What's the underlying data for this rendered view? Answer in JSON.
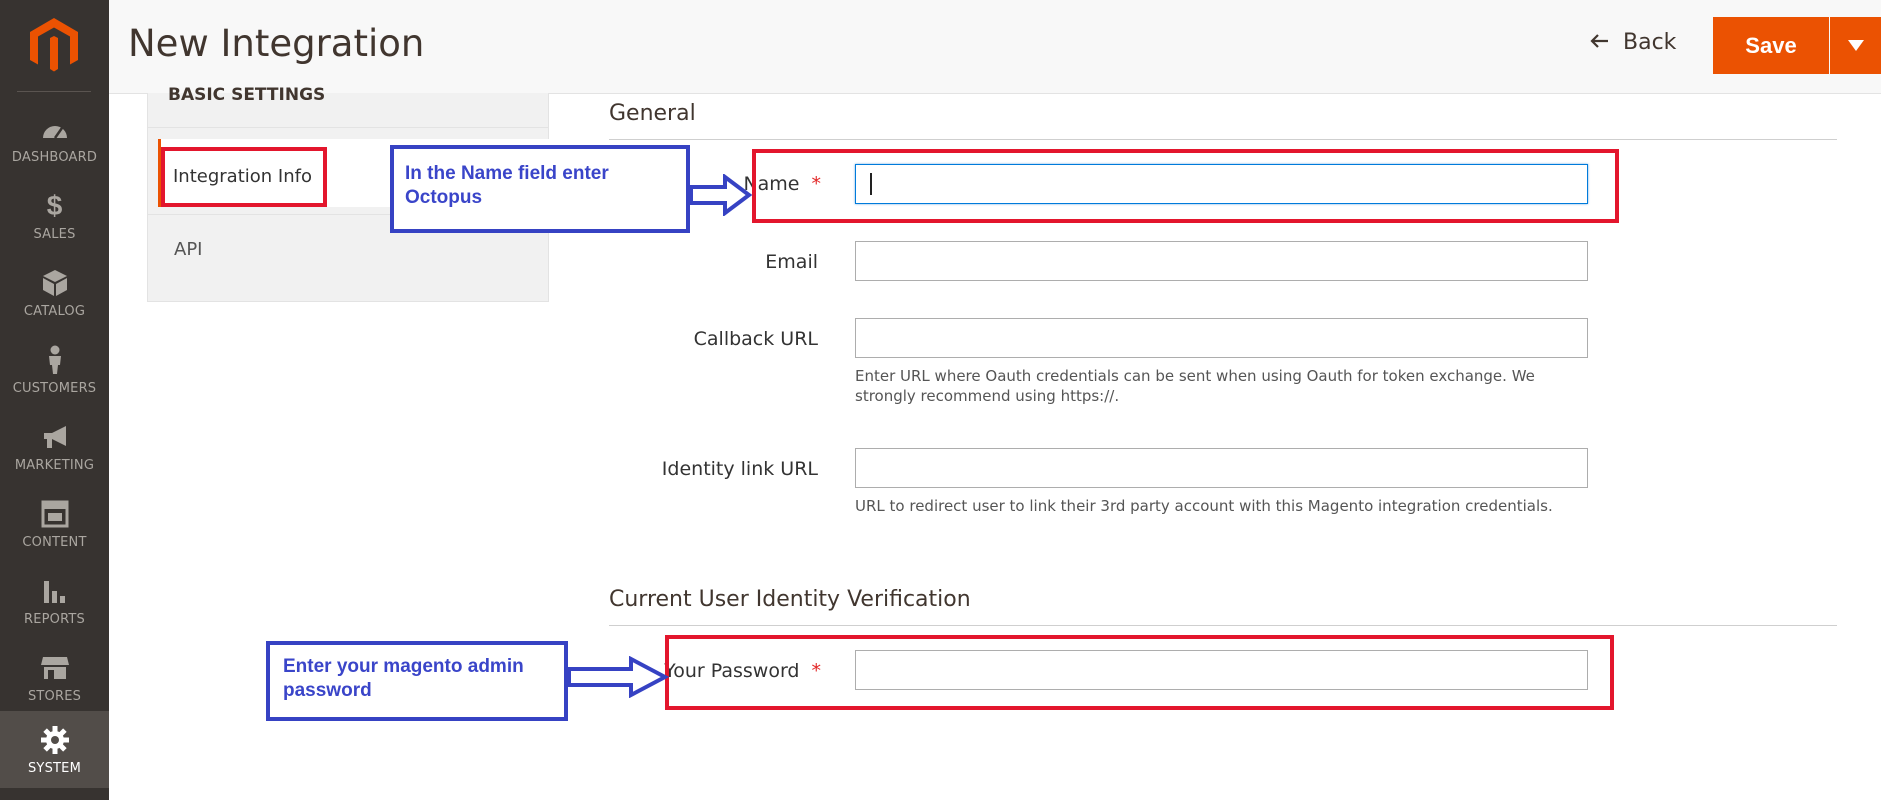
{
  "header": {
    "title": "New Integration",
    "back_label": "Back",
    "save_label": "Save"
  },
  "menu": [
    {
      "label": "DASHBOARD",
      "icon": "dashboard-icon"
    },
    {
      "label": "SALES",
      "icon": "dollar-icon"
    },
    {
      "label": "CATALOG",
      "icon": "box-icon"
    },
    {
      "label": "CUSTOMERS",
      "icon": "person-icon"
    },
    {
      "label": "MARKETING",
      "icon": "megaphone-icon"
    },
    {
      "label": "CONTENT",
      "icon": "layout-icon"
    },
    {
      "label": "REPORTS",
      "icon": "bar-chart-icon"
    },
    {
      "label": "STORES",
      "icon": "storefront-icon"
    },
    {
      "label": "SYSTEM",
      "icon": "gear-icon",
      "active": true
    }
  ],
  "tabs": {
    "heading": "BASIC SETTINGS",
    "items": [
      {
        "label": "Integration Info",
        "active": true
      },
      {
        "label": "API"
      }
    ]
  },
  "general": {
    "title": "General",
    "name_label": "Name",
    "name_value": "",
    "email_label": "Email",
    "email_value": "",
    "callback_label": "Callback URL",
    "callback_value": "",
    "callback_note": "Enter URL where Oauth credentials can be sent when using Oauth for token exchange. We strongly recommend using https://.",
    "identity_label": "Identity link URL",
    "identity_value": "",
    "identity_note": "URL to redirect user to link their 3rd party account with this Magento integration credentials."
  },
  "verification": {
    "title": "Current User Identity Verification",
    "password_label": "Your Password",
    "password_value": ""
  },
  "required_mark": "*",
  "annotations": {
    "name_callout": "In the Name field enter Octopus",
    "password_callout": "Enter your magento admin password"
  },
  "colors": {
    "accent": "#eb5202",
    "menu_bg": "#373330",
    "annotation_red": "#e3162d",
    "annotation_blue": "#3642c3"
  }
}
